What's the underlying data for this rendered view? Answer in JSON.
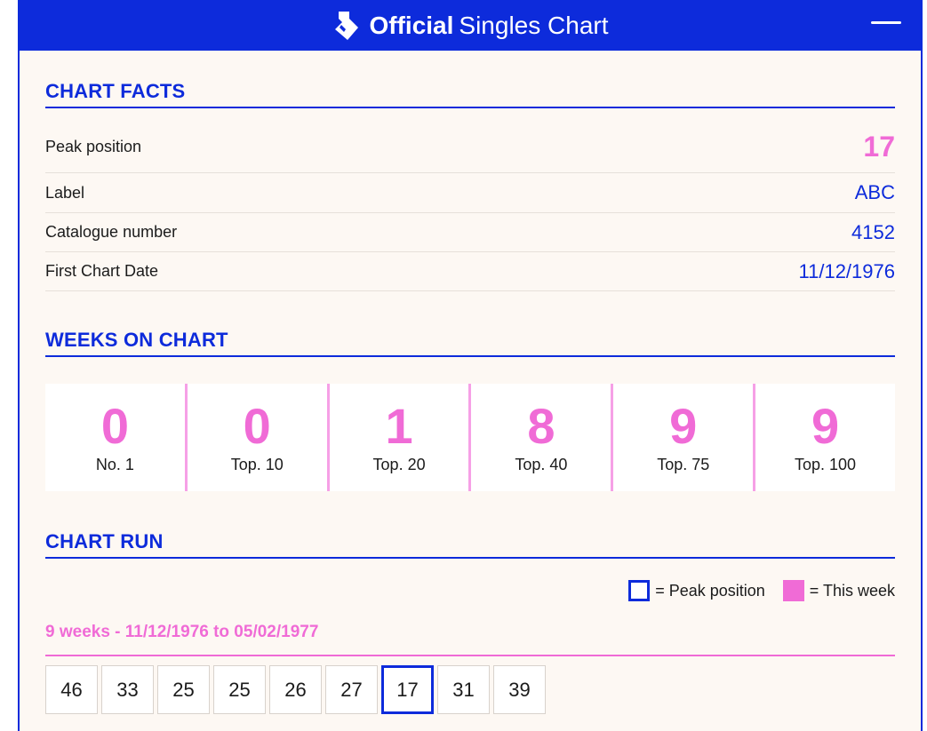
{
  "header": {
    "brand_bold": "Official",
    "brand_light": "Singles Chart"
  },
  "colors": {
    "primary": "#0d2bdb",
    "accent": "#f06bd6",
    "background": "#fdf8f3"
  },
  "chart_facts": {
    "title": "CHART FACTS",
    "rows": [
      {
        "label": "Peak position",
        "value": "17"
      },
      {
        "label": "Label",
        "value": "ABC"
      },
      {
        "label": "Catalogue number",
        "value": "4152"
      },
      {
        "label": "First Chart Date",
        "value": "11/12/1976"
      }
    ]
  },
  "weeks_on_chart": {
    "title": "WEEKS ON CHART",
    "cells": [
      {
        "count": "0",
        "label": "No. 1"
      },
      {
        "count": "0",
        "label": "Top. 10"
      },
      {
        "count": "1",
        "label": "Top. 20"
      },
      {
        "count": "8",
        "label": "Top. 40"
      },
      {
        "count": "9",
        "label": "Top. 75"
      },
      {
        "count": "9",
        "label": "Top. 100"
      }
    ]
  },
  "chart_run": {
    "title": "CHART RUN",
    "legend_peak": "= Peak position",
    "legend_week": "= This week",
    "summary": "9 weeks - 11/12/1976 to 05/02/1977",
    "positions": [
      "46",
      "33",
      "25",
      "25",
      "26",
      "27",
      "17",
      "31",
      "39"
    ],
    "peak_index": 6
  }
}
